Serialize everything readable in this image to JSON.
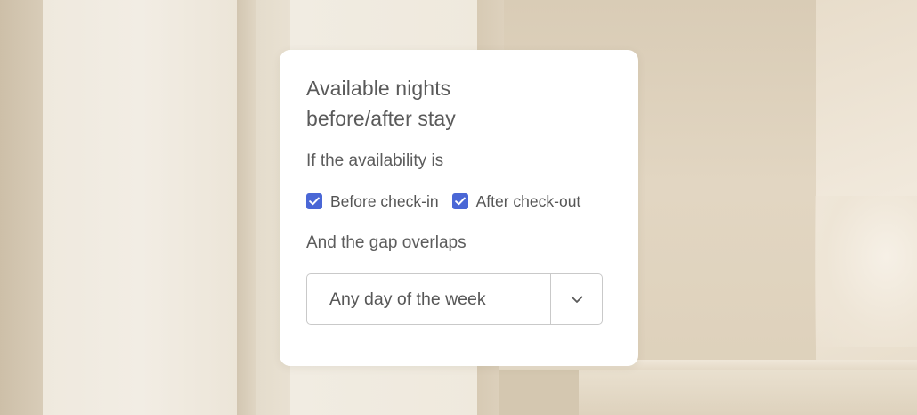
{
  "card": {
    "title": "Available nights before/after stay",
    "availability_label": "If the availability is",
    "options": [
      {
        "label": "Before check-in",
        "checked": true
      },
      {
        "label": "After check-out",
        "checked": true
      }
    ],
    "gap_label": "And the gap overlaps",
    "select": {
      "value": "Any day of the week",
      "icon": "chevron-down-icon"
    }
  },
  "colors": {
    "checkbox_accent": "#4a67d6",
    "card_background": "#ffffff",
    "text": "#5a5a5a",
    "border": "#c9c9c9"
  }
}
